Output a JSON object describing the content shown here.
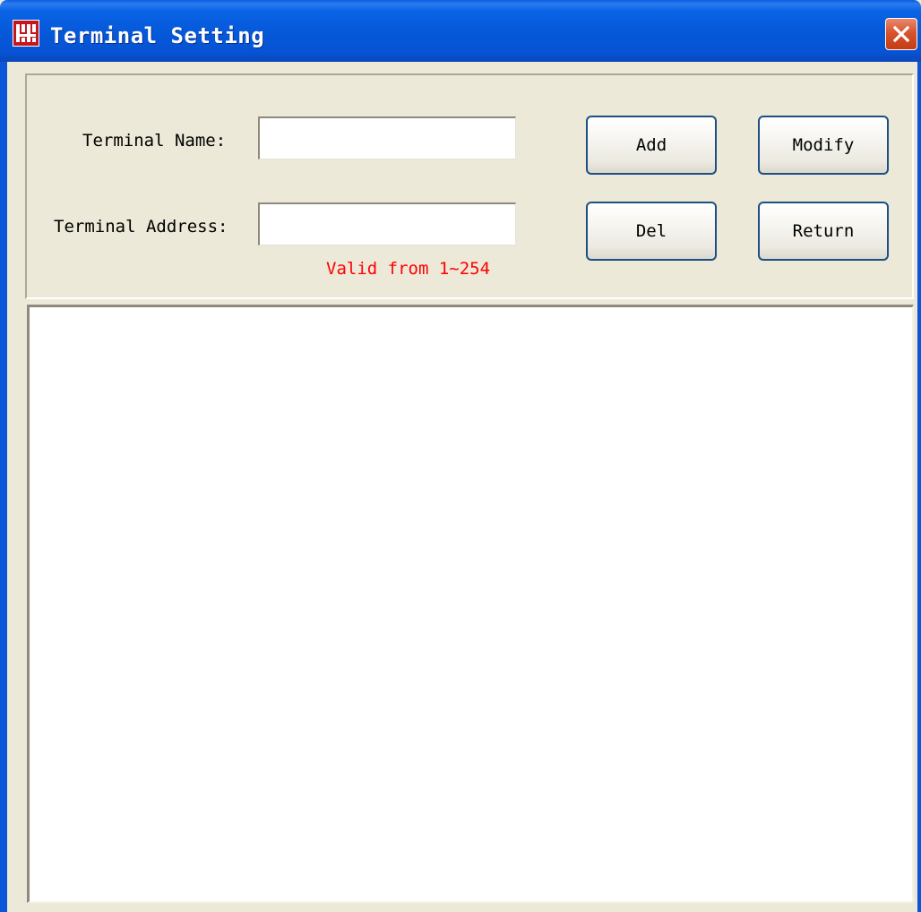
{
  "window": {
    "title": "Terminal Setting",
    "icon": "app-logo-icon",
    "close_icon": "close-icon"
  },
  "form": {
    "name_label": "Terminal Name:",
    "name_value": "",
    "address_label": "Terminal Address:",
    "address_value": "",
    "address_hint": "Valid from 1~254"
  },
  "buttons": {
    "add": "Add",
    "modify": "Modify",
    "del": "Del",
    "return": "Return"
  },
  "list": {
    "items": []
  },
  "colors": {
    "titlebar": "#0558d8",
    "hint": "#ff0000",
    "background": "#ece9d8"
  }
}
